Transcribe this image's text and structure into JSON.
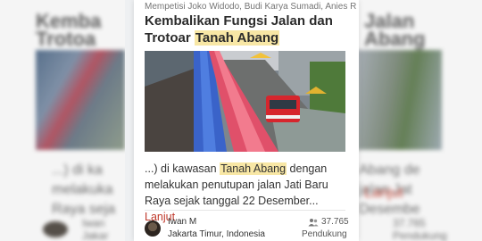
{
  "card": {
    "targets": "Mempetisi Joko Widodo, Budi Karya Sumadi, Anies R",
    "title_part1": "Kembalikan Fungsi Jalan dan Trotoar ",
    "title_highlight": "Tanah Abang",
    "desc_part1": "...) di kawasan ",
    "desc_highlight": "Tanah Abang",
    "desc_part2": " dengan melakukan penutupan jalan Jati Baru Raya sejak tanggal 22 Desember... ",
    "more_label": "Lanjut",
    "author_name": "Iwan M",
    "author_location": "Jakarta Timur, Indonesia",
    "supporters_count": "37.765",
    "supporters_label": "Pendukung",
    "colors": {
      "highlight": "#f8e7a5",
      "link": "#c0392b"
    }
  },
  "background": {
    "left_title_fragment": "Kemba\nTrotoa",
    "left_desc_fragment": "...) di ka\nmelakuka\nRaya seja",
    "right_title_fragment": "Jalan\nAbang",
    "right_desc_fragment": "Abang de\njalan Jat\nDesembe",
    "right_more_fragment": "Lanjut",
    "left_author_fragment": "Iwan\nJakar",
    "right_count_fragment": "37.765\nPendukung"
  }
}
